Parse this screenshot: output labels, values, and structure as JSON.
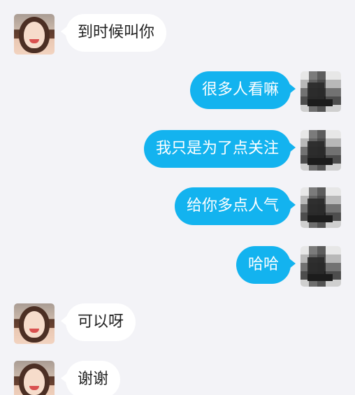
{
  "messages": [
    {
      "sender": "them",
      "text": "到时候叫你"
    },
    {
      "sender": "me",
      "text": "很多人看嘛"
    },
    {
      "sender": "me",
      "text": "我只是为了点关注"
    },
    {
      "sender": "me",
      "text": "给你多点人气"
    },
    {
      "sender": "me",
      "text": "哈哈"
    },
    {
      "sender": "them",
      "text": "可以呀"
    },
    {
      "sender": "them",
      "text": "谢谢"
    }
  ],
  "colors": {
    "background": "#f3f3f7",
    "incoming_bubble": "#ffffff",
    "outgoing_bubble": "#13b3ef"
  }
}
